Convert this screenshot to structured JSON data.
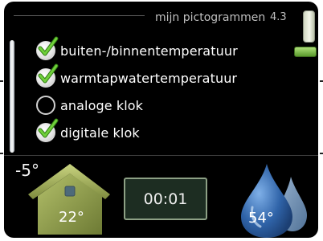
{
  "header": {
    "title": "mijn pictogrammen",
    "code": "4.3"
  },
  "options": [
    {
      "label": "buiten-/binnentemperatuur",
      "checked": true
    },
    {
      "label": "warmtapwatertemperatuur",
      "checked": true
    },
    {
      "label": "analoge klok",
      "checked": false
    },
    {
      "label": "digitale klok",
      "checked": true
    }
  ],
  "status": {
    "outdoor_temp": "-5°",
    "indoor_temp": "22°",
    "clock": "00:01",
    "hot_water_temp": "54°"
  },
  "colors": {
    "check_green": "#5ab52a",
    "house_green": "#8a9a4a",
    "drop_blue": "#3b73b5"
  },
  "icons": [
    "check-icon",
    "house-icon",
    "water-drop-icon"
  ]
}
